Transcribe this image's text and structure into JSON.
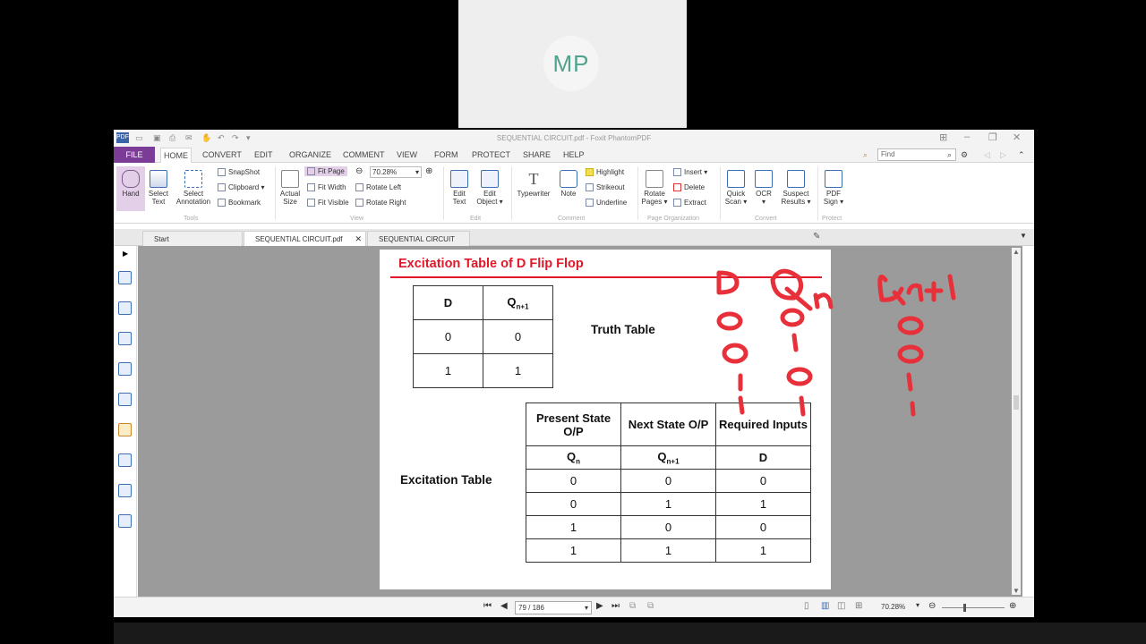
{
  "webcam": {
    "initials": "MP"
  },
  "window": {
    "title": "SEQUENTIAL CIRCUIT.pdf - Foxit PhantomPDF",
    "app_icon": "PDF"
  },
  "menu": {
    "file": "FILE",
    "tabs": [
      "HOME",
      "CONVERT",
      "EDIT",
      "ORGANIZE",
      "COMMENT",
      "VIEW",
      "FORM",
      "PROTECT",
      "SHARE",
      "HELP"
    ],
    "find_placeholder": "Find"
  },
  "ribbon": {
    "hand": "Hand",
    "select_text": [
      "Select",
      "Text"
    ],
    "select_annotation": [
      "Select",
      "Annotation"
    ],
    "snapshot": "SnapShot",
    "clipboard": "Clipboard",
    "bookmark": "Bookmark",
    "tools_group": "Tools",
    "actual_size": [
      "Actual",
      "Size"
    ],
    "fit_page": "Fit Page",
    "fit_width": "Fit Width",
    "fit_visible": "Fit Visible",
    "zoom_value": "70.28%",
    "rotate_left": "Rotate Left",
    "rotate_right": "Rotate Right",
    "view_group": "View",
    "edit_text": [
      "Edit",
      "Text"
    ],
    "edit_object": [
      "Edit",
      "Object"
    ],
    "edit_group": "Edit",
    "typewriter": "Typewriter",
    "note": "Note",
    "highlight": "Highlight",
    "strikeout": "Strikeout",
    "underline": "Underline",
    "comment_group": "Comment",
    "rotate_pages": [
      "Rotate",
      "Pages"
    ],
    "insert": "Insert",
    "delete": "Delete",
    "extract": "Extract",
    "page_org_group": "Page Organization",
    "quick_scan": [
      "Quick",
      "Scan"
    ],
    "ocr": "OCR",
    "suspect_results": [
      "Suspect",
      "Results"
    ],
    "convert_group": "Convert",
    "pdf_sign": [
      "PDF",
      "Sign"
    ],
    "protect_group": "Protect"
  },
  "doc_tabs": [
    "Start",
    "SEQUENTIAL CIRCUIT.pdf",
    "SEQUENTIAL CIRCUIT -..."
  ],
  "page": {
    "heading": "Excitation Table of  D Flip Flop",
    "truth_table_label": "Truth Table",
    "excitation_table_label": "Excitation Table",
    "truth_table": {
      "headers": [
        "D",
        "Q",
        "n+1"
      ],
      "rows": [
        [
          "0",
          "0"
        ],
        [
          "1",
          "1"
        ]
      ]
    },
    "excitation_table": {
      "headers": [
        "Present State O/P",
        "Next State O/P",
        "Required Inputs"
      ],
      "subheaders": [
        "Q",
        "n",
        "Q",
        "n+1",
        "D"
      ],
      "rows": [
        [
          "0",
          "0",
          "0"
        ],
        [
          "0",
          "1",
          "1"
        ],
        [
          "1",
          "0",
          "0"
        ],
        [
          "1",
          "1",
          "1"
        ]
      ]
    }
  },
  "status": {
    "page_indicator": "79 / 186",
    "zoom": "70.28%"
  },
  "colors": {
    "file_tab": "#7b3c98",
    "heading_red": "#e0182a",
    "ink": "#e8303a"
  }
}
